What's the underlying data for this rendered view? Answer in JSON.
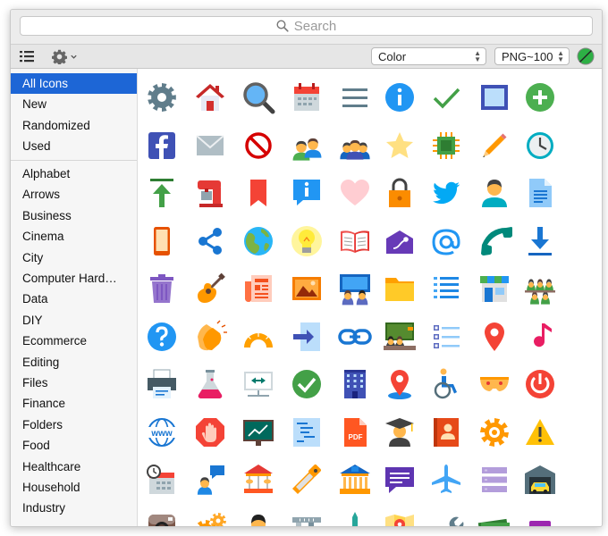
{
  "search": {
    "placeholder": "Search"
  },
  "toolbar": {
    "list_icon": "list-icon",
    "settings_icon": "gear-icon",
    "color_select": "Color",
    "format_select": "PNG~100",
    "color_swatch": "#2db045"
  },
  "sidebar": {
    "top_items": [
      {
        "label": "All Icons",
        "selected": true
      },
      {
        "label": "New"
      },
      {
        "label": "Randomized"
      },
      {
        "label": "Used"
      }
    ],
    "categories": [
      "Alphabet",
      "Arrows",
      "Business",
      "Cinema",
      "City",
      "Computer Hard…",
      "Data",
      "DIY",
      "Ecommerce",
      "Editing",
      "Files",
      "Finance",
      "Folders",
      "Food",
      "Healthcare",
      "Household",
      "Industry"
    ]
  },
  "icons": [
    [
      "settings",
      "home",
      "search",
      "calendar",
      "menu",
      "info",
      "checkmark",
      "picture-frame",
      "plus"
    ],
    [
      "facebook",
      "mail",
      "no-entry",
      "conference",
      "group",
      "star",
      "microchip",
      "pencil",
      "clock"
    ],
    [
      "upload",
      "kitchen-mixer",
      "bookmark",
      "info-bubble",
      "heart",
      "lock",
      "twitter",
      "user",
      "document"
    ],
    [
      "smartphone",
      "share",
      "globe",
      "idea",
      "open-book",
      "envelope-sperm",
      "at-sign",
      "phone",
      "download"
    ],
    [
      "trash",
      "guitar",
      "newspaper",
      "image",
      "video-conference",
      "folder",
      "list",
      "shop",
      "meeting"
    ],
    [
      "help",
      "applause",
      "protractor",
      "import",
      "link",
      "classroom",
      "checklist",
      "location",
      "music"
    ],
    [
      "printer",
      "lab",
      "network-panel",
      "ok",
      "building",
      "marker",
      "disabled",
      "underwear",
      "shutdown"
    ],
    [
      "www",
      "stop-hand",
      "chalkboard",
      "code",
      "pdf",
      "graduate",
      "contacts",
      "settings-cog",
      "warning"
    ],
    [
      "schedule",
      "chat-user",
      "carousel",
      "chainsaw",
      "museum",
      "speech-bubble",
      "airplane",
      "database",
      "garage"
    ],
    [
      "instagram",
      "gears",
      "businessman",
      "caliper",
      "monument",
      "map",
      "wrench",
      "money",
      "sofa"
    ]
  ]
}
